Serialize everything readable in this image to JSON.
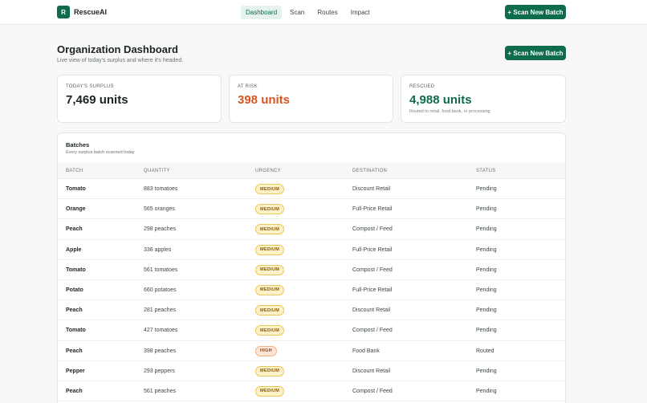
{
  "app": {
    "logo_letter": "R",
    "name": "RescueAI"
  },
  "nav": [
    {
      "label": "Dashboard",
      "active": true
    },
    {
      "label": "Scan",
      "active": false
    },
    {
      "label": "Routes",
      "active": false
    },
    {
      "label": "Impact",
      "active": false
    }
  ],
  "header": {
    "scan_button": "+ Scan New Batch"
  },
  "page": {
    "title": "Organization Dashboard",
    "subtitle": "Live view of today's surplus and where it's headed.",
    "scan_button": "+ Scan New Batch"
  },
  "stats": [
    {
      "label": "TODAY'S SURPLUS",
      "value": "7,469 units",
      "note": "",
      "color": "#1c2421"
    },
    {
      "label": "AT RISK",
      "value": "398 units",
      "note": "",
      "color": "#d9541e"
    },
    {
      "label": "RESCUED",
      "value": "4,988 units",
      "note": "Routed to retail, food bank, or processing",
      "color": "#0e6b4c"
    }
  ],
  "batches": {
    "title": "Batches",
    "subtitle": "Every surplus batch scanned today",
    "columns": [
      "BATCH",
      "QUANTITY",
      "URGENCY",
      "DESTINATION",
      "STATUS"
    ],
    "rows": [
      {
        "batch": "Tomato",
        "quantity": "883 tomatoes",
        "urgency": "MEDIUM",
        "destination": "Discount Retail",
        "status": "Pending"
      },
      {
        "batch": "Orange",
        "quantity": "565 oranges",
        "urgency": "MEDIUM",
        "destination": "Full-Price Retail",
        "status": "Pending"
      },
      {
        "batch": "Peach",
        "quantity": "298 peaches",
        "urgency": "MEDIUM",
        "destination": "Compost / Feed",
        "status": "Pending"
      },
      {
        "batch": "Apple",
        "quantity": "336 apples",
        "urgency": "MEDIUM",
        "destination": "Full-Price Retail",
        "status": "Pending"
      },
      {
        "batch": "Tomato",
        "quantity": "561 tomatoes",
        "urgency": "MEDIUM",
        "destination": "Compost / Feed",
        "status": "Pending"
      },
      {
        "batch": "Potato",
        "quantity": "660 potatoes",
        "urgency": "MEDIUM",
        "destination": "Full-Price Retail",
        "status": "Pending"
      },
      {
        "batch": "Peach",
        "quantity": "281 peaches",
        "urgency": "MEDIUM",
        "destination": "Discount Retail",
        "status": "Pending"
      },
      {
        "batch": "Tomato",
        "quantity": "427 tomatoes",
        "urgency": "MEDIUM",
        "destination": "Compost / Feed",
        "status": "Pending"
      },
      {
        "batch": "Peach",
        "quantity": "398 peaches",
        "urgency": "HIGH",
        "destination": "Food Bank",
        "status": "Routed"
      },
      {
        "batch": "Pepper",
        "quantity": "293 peppers",
        "urgency": "MEDIUM",
        "destination": "Discount Retail",
        "status": "Pending"
      },
      {
        "batch": "Peach",
        "quantity": "561 peaches",
        "urgency": "MEDIUM",
        "destination": "Compost / Feed",
        "status": "Pending"
      }
    ]
  }
}
